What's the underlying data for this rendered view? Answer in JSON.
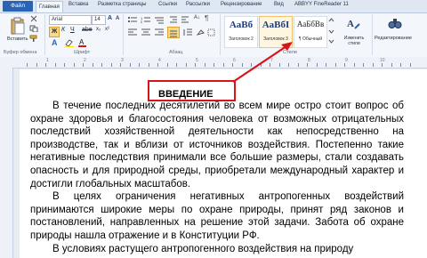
{
  "ribbon": {
    "tabs": [
      "Файл",
      "Главная",
      "Вставка",
      "Разметка страницы",
      "Ссылки",
      "Рассылки",
      "Рецензирование",
      "Вид",
      "ABBYY FineReader 11"
    ],
    "active_tab": "Главная",
    "clipboard": {
      "paste_label": "Вставить",
      "group_label": "Буфер обмена"
    },
    "font": {
      "name": "Arial",
      "size": "14",
      "group_label": "Шрифт"
    },
    "paragraph": {
      "group_label": "Абзац"
    },
    "styles": {
      "group_label": "Стили",
      "tiles": [
        {
          "sample": "AaBб",
          "name": "Заголовок 2"
        },
        {
          "sample": "AaBбI",
          "name": "Заголовок 3"
        },
        {
          "sample": "АаБбВв",
          "name": "¶ Обычный"
        }
      ],
      "change_styles_label": "Изменить стили",
      "editing_label": "Редактирование"
    }
  },
  "document": {
    "heading": "ВВЕДЕНИЕ",
    "paragraphs": [
      "В течение последних десятилетий во всем мире остро стоит вопрос об охране здоровья и благосостояния человека от возможных отрицательных последствий хозяйственной деятельности как непосредственно на производстве, так и вблизи от источников воздействия. Постепенно такие негативные последствия принимали все большие размеры, стали создавать опасность и для природной среды, приобретали международный характер и достигли глобальных масштабов.",
      "В целях ограничения негативных антропогенных воздействий принимаются широкие меры по охране природы, принят ряд законов и постановлений, направленных на решение этой задачи. Забота об охране природы нашла отражение и в Конституции РФ.",
      "В условиях растущего антропогенного воздействия на природу"
    ]
  },
  "colors": {
    "accent": "#2c62b3",
    "highlight": "#d8141b"
  }
}
